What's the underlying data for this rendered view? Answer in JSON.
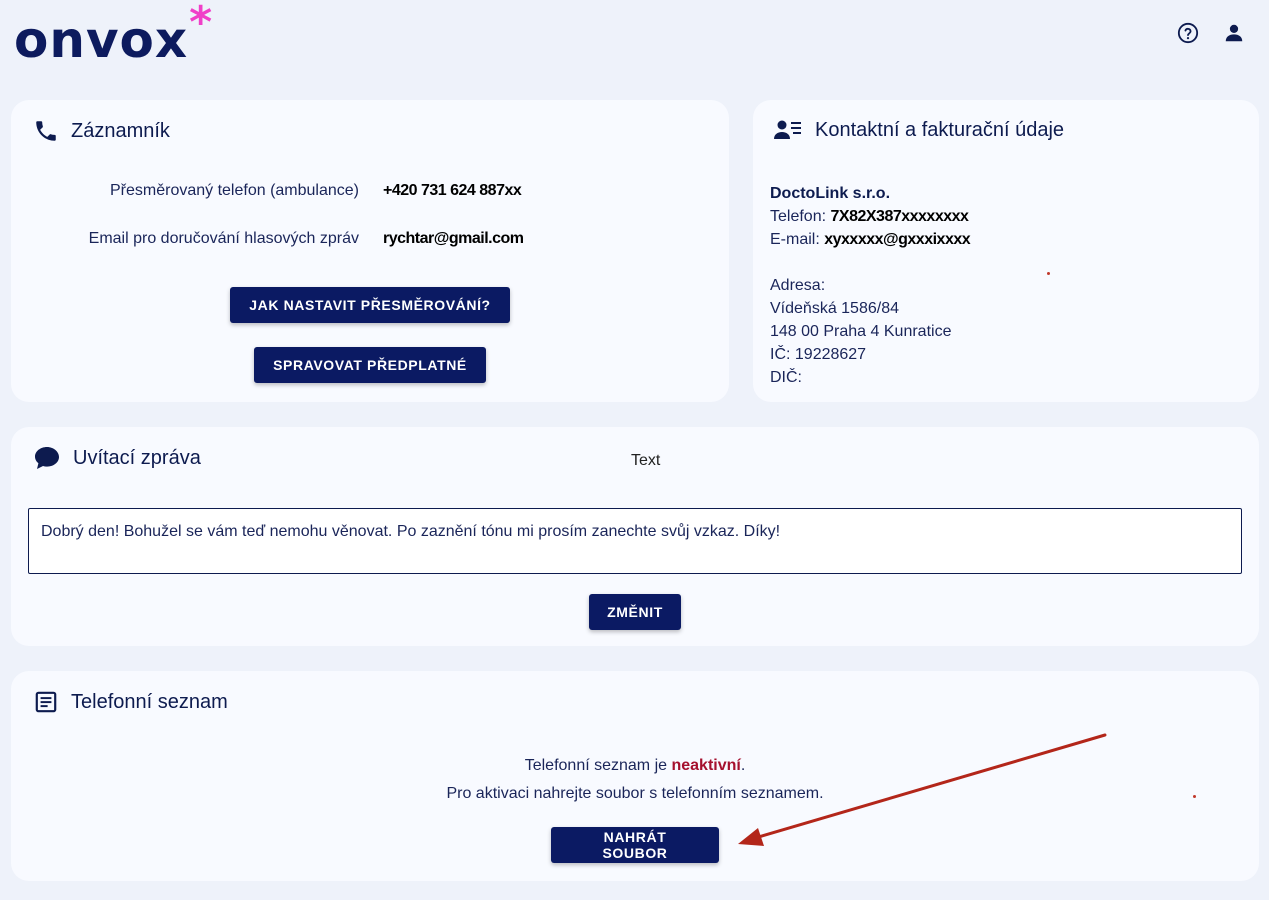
{
  "header": {
    "logo_text": "onvox",
    "logo_star": "*",
    "help_icon": "help-circle-icon",
    "user_icon": "user-icon"
  },
  "voicemail": {
    "title": "Záznamník",
    "icon": "phone-icon",
    "redirected_phone_label": "Přesměrovaný telefon (ambulance)",
    "redirected_phone_value": "+420 731 624 887xx",
    "email_label": "Email pro doručování hlasových zpráv",
    "email_value": "rychtar@gmail.com",
    "how_to_redirect_button": "JAK NASTAVIT PŘESMĚROVÁNÍ?",
    "manage_subscription_button": "SPRAVOVAT PŘEDPLATNÉ"
  },
  "contact": {
    "title": "Kontaktní a fakturační údaje",
    "icon": "contact-list-icon",
    "company": "DoctoLink s.r.o.",
    "phone_label": "Telefon:",
    "phone_value": "7X82X387xxxxxxxx",
    "email_label": "E-mail:",
    "email_value": "xyxxxxx@gxxxixxxx",
    "address_label": "Adresa:",
    "street": "Vídeňská 1586/84",
    "city": "148 00 Praha 4 Kunratice",
    "ic": "IČ: 19228627",
    "dic": "DIČ:"
  },
  "greeting": {
    "title": "Uvítací zpráva",
    "icon": "chat-bubble-icon",
    "text_label": "Text",
    "message": "Dobrý den! Bohužel se vám teď nemohu věnovat. Po zaznění tónu mi prosím zanechte svůj vzkaz. Díky!",
    "change_button": "ZMĚNIT"
  },
  "phonebook": {
    "title": "Telefonní seznam",
    "icon": "document-list-icon",
    "status_prefix": "Telefonní seznam je ",
    "status_value": "neaktivní",
    "status_suffix": ".",
    "hint": "Pro aktivaci nahrejte soubor s telefonním seznamem.",
    "upload_button": "NAHRÁT SOUBOR"
  },
  "colors": {
    "primary": "#0b1a63",
    "accent_star": "#f03fc8",
    "inactive": "#a5102e",
    "annotation": "#c0392b",
    "background": "#eef2fa",
    "card": "#f8faff"
  }
}
